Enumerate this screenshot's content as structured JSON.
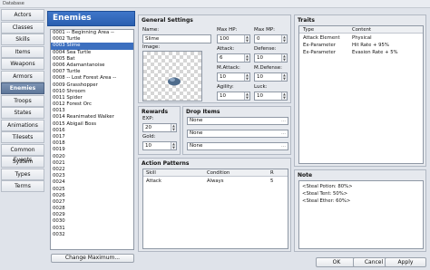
{
  "window": {
    "title": "Database"
  },
  "tabs": [
    "Actors",
    "Classes",
    "Skills",
    "Items",
    "Weapons",
    "Armors",
    "Enemies",
    "Troops",
    "States",
    "Animations",
    "Tilesets",
    "Common Events",
    "System",
    "Types",
    "Terms"
  ],
  "active_tab": "Enemies",
  "enemy_list": {
    "header": "Enemies",
    "items": [
      "0001 -- Beginning Area --",
      "0002 Turtle",
      "0003 Slime",
      "0004 Sea Turtle",
      "0005 Bat",
      "0006 Adamantanoise",
      "0007 Turtle",
      "0008 -- Lost Forest Area --",
      "0009 Grasshopper",
      "0010 Shroom",
      "0011 Spider",
      "0012 Forest Orc",
      "0013",
      "0014 Reanimated Walker",
      "0015 Abigail Boss",
      "0016",
      "0017",
      "0018",
      "0019",
      "0020",
      "0021",
      "0022",
      "0023",
      "0024",
      "0025",
      "0026",
      "0027",
      "0028",
      "0029",
      "0030",
      "0031",
      "0032"
    ],
    "selected_index": 2,
    "change_max_label": "Change Maximum..."
  },
  "general": {
    "title": "General Settings",
    "name_label": "Name:",
    "name_value": "Slime",
    "image_label": "Image:",
    "max_hp_label": "Max HP:",
    "max_hp": "100",
    "max_mp_label": "Max MP:",
    "max_mp": "0",
    "attack_label": "Attack:",
    "attack": "6",
    "defense_label": "Defense:",
    "defense": "10",
    "mattack_label": "M.Attack:",
    "mattack": "10",
    "mdefense_label": "M.Defense:",
    "mdefense": "10",
    "agility_label": "Agility:",
    "agility": "10",
    "luck_label": "Luck:",
    "luck": "10"
  },
  "rewards": {
    "title": "Rewards",
    "exp_label": "EXP:",
    "exp": "20",
    "gold_label": "Gold:",
    "gold": "10"
  },
  "drops": {
    "title": "Drop Items",
    "items": [
      "None",
      "None",
      "None"
    ]
  },
  "actions": {
    "title": "Action Patterns",
    "headers": [
      "Skill",
      "Condition",
      "R"
    ],
    "rows": [
      [
        "Attack",
        "Always",
        "5"
      ]
    ]
  },
  "traits": {
    "title": "Traits",
    "headers": [
      "Type",
      "Content"
    ],
    "rows": [
      [
        "Attack Element",
        "Physical"
      ],
      [
        "Ex-Parameter",
        "Hit Rate + 95%"
      ],
      [
        "Ex-Parameter",
        "Evasion Rate + 5%"
      ]
    ]
  },
  "note": {
    "title": "Note",
    "lines": [
      "<Steal Potion: 80%>",
      "<Steal Tent: 50%>",
      "<Steal Ether: 60%>"
    ]
  },
  "footer": {
    "ok": "OK",
    "cancel": "Cancel",
    "apply": "Apply"
  }
}
